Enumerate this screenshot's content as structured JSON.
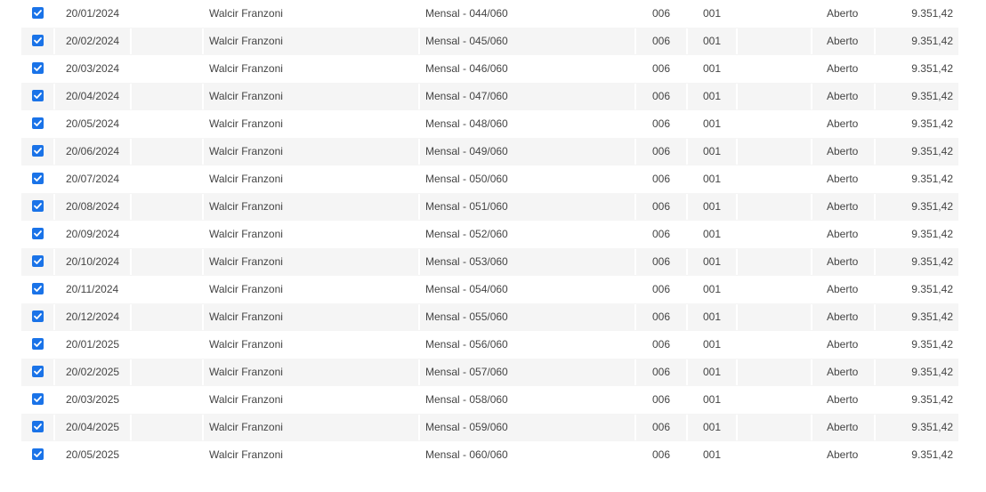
{
  "colors": {
    "checkbox": "#1a73e8",
    "row_alt": "#f5f5f5",
    "text": "#444444"
  },
  "rows": [
    {
      "checked": true,
      "date": "20/01/2024",
      "name": "Walcir Franzoni",
      "description": "Mensal - 044/060",
      "col_a": "006",
      "col_b": "001",
      "status": "Aberto",
      "value": "9.351,42"
    },
    {
      "checked": true,
      "date": "20/02/2024",
      "name": "Walcir Franzoni",
      "description": "Mensal - 045/060",
      "col_a": "006",
      "col_b": "001",
      "status": "Aberto",
      "value": "9.351,42"
    },
    {
      "checked": true,
      "date": "20/03/2024",
      "name": "Walcir Franzoni",
      "description": "Mensal - 046/060",
      "col_a": "006",
      "col_b": "001",
      "status": "Aberto",
      "value": "9.351,42"
    },
    {
      "checked": true,
      "date": "20/04/2024",
      "name": "Walcir Franzoni",
      "description": "Mensal - 047/060",
      "col_a": "006",
      "col_b": "001",
      "status": "Aberto",
      "value": "9.351,42"
    },
    {
      "checked": true,
      "date": "20/05/2024",
      "name": "Walcir Franzoni",
      "description": "Mensal - 048/060",
      "col_a": "006",
      "col_b": "001",
      "status": "Aberto",
      "value": "9.351,42"
    },
    {
      "checked": true,
      "date": "20/06/2024",
      "name": "Walcir Franzoni",
      "description": "Mensal - 049/060",
      "col_a": "006",
      "col_b": "001",
      "status": "Aberto",
      "value": "9.351,42"
    },
    {
      "checked": true,
      "date": "20/07/2024",
      "name": "Walcir Franzoni",
      "description": "Mensal - 050/060",
      "col_a": "006",
      "col_b": "001",
      "status": "Aberto",
      "value": "9.351,42"
    },
    {
      "checked": true,
      "date": "20/08/2024",
      "name": "Walcir Franzoni",
      "description": "Mensal - 051/060",
      "col_a": "006",
      "col_b": "001",
      "status": "Aberto",
      "value": "9.351,42"
    },
    {
      "checked": true,
      "date": "20/09/2024",
      "name": "Walcir Franzoni",
      "description": "Mensal - 052/060",
      "col_a": "006",
      "col_b": "001",
      "status": "Aberto",
      "value": "9.351,42"
    },
    {
      "checked": true,
      "date": "20/10/2024",
      "name": "Walcir Franzoni",
      "description": "Mensal - 053/060",
      "col_a": "006",
      "col_b": "001",
      "status": "Aberto",
      "value": "9.351,42"
    },
    {
      "checked": true,
      "date": "20/11/2024",
      "name": "Walcir Franzoni",
      "description": "Mensal - 054/060",
      "col_a": "006",
      "col_b": "001",
      "status": "Aberto",
      "value": "9.351,42"
    },
    {
      "checked": true,
      "date": "20/12/2024",
      "name": "Walcir Franzoni",
      "description": "Mensal - 055/060",
      "col_a": "006",
      "col_b": "001",
      "status": "Aberto",
      "value": "9.351,42"
    },
    {
      "checked": true,
      "date": "20/01/2025",
      "name": "Walcir Franzoni",
      "description": "Mensal - 056/060",
      "col_a": "006",
      "col_b": "001",
      "status": "Aberto",
      "value": "9.351,42"
    },
    {
      "checked": true,
      "date": "20/02/2025",
      "name": "Walcir Franzoni",
      "description": "Mensal - 057/060",
      "col_a": "006",
      "col_b": "001",
      "status": "Aberto",
      "value": "9.351,42"
    },
    {
      "checked": true,
      "date": "20/03/2025",
      "name": "Walcir Franzoni",
      "description": "Mensal - 058/060",
      "col_a": "006",
      "col_b": "001",
      "status": "Aberto",
      "value": "9.351,42"
    },
    {
      "checked": true,
      "date": "20/04/2025",
      "name": "Walcir Franzoni",
      "description": "Mensal - 059/060",
      "col_a": "006",
      "col_b": "001",
      "status": "Aberto",
      "value": "9.351,42"
    },
    {
      "checked": true,
      "date": "20/05/2025",
      "name": "Walcir Franzoni",
      "description": "Mensal - 060/060",
      "col_a": "006",
      "col_b": "001",
      "status": "Aberto",
      "value": "9.351,42"
    }
  ]
}
